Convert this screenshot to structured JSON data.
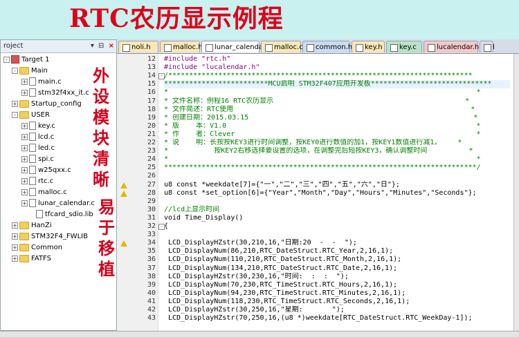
{
  "banner": {
    "title": "RTC农历显示例程"
  },
  "side_text": {
    "left": "外设模块清晰",
    "right": "易于移植"
  },
  "project": {
    "header": "roject",
    "controls": {
      "pin": "▾",
      "dock": "⊟",
      "close": "×"
    },
    "tree": [
      {
        "label": "Target 1",
        "type": "target",
        "exp": "-"
      },
      {
        "label": "Main",
        "type": "folder",
        "exp": "-"
      },
      {
        "label": "main.c",
        "type": "file",
        "exp": "+"
      },
      {
        "label": "stm32f4xx_it.c",
        "type": "file",
        "exp": "+"
      },
      {
        "label": "Startup_config",
        "type": "folder",
        "exp": "+"
      },
      {
        "label": "USER",
        "type": "folder",
        "exp": "-"
      },
      {
        "label": "key.c",
        "type": "file",
        "exp": "+"
      },
      {
        "label": "lcd.c",
        "type": "file",
        "exp": "+"
      },
      {
        "label": "led.c",
        "type": "file",
        "exp": "+"
      },
      {
        "label": "spi.c",
        "type": "file",
        "exp": "+"
      },
      {
        "label": "w25qxx.c",
        "type": "file",
        "exp": "+"
      },
      {
        "label": "rtc.c",
        "type": "file",
        "exp": "+"
      },
      {
        "label": "malloc.c",
        "type": "file",
        "exp": "+"
      },
      {
        "label": "lunar_calendar.c",
        "type": "file",
        "exp": "+"
      },
      {
        "label": "tfcard_sdio.lib",
        "type": "file",
        "exp": ""
      },
      {
        "label": "HanZi",
        "type": "folder",
        "exp": "+"
      },
      {
        "label": "STM32F4_FWLIB",
        "type": "folder",
        "exp": "+"
      },
      {
        "label": "Common",
        "type": "folder",
        "exp": "+"
      },
      {
        "label": "FATFS",
        "type": "folder",
        "exp": "+"
      }
    ]
  },
  "tabs": [
    {
      "label": "noli.h",
      "color": "#f8e7b8"
    },
    {
      "label": "malloc.h",
      "color": "#f8e7b8"
    },
    {
      "label": "lunar_calendar.c",
      "color": "#ffffff"
    },
    {
      "label": "malloc.c",
      "color": "#f8e7b8"
    },
    {
      "label": "common.h",
      "color": "#c9dcf1"
    },
    {
      "label": "key.h",
      "color": "#f8e7b8"
    },
    {
      "label": "key.c",
      "color": "#b9e2c4"
    },
    {
      "label": "lucalendar.h",
      "color": "#f3c8c8"
    },
    {
      "label": "l",
      "color": "#d7dde6"
    }
  ],
  "code_lines": [
    {
      "n": "12",
      "text": "#include \"rtc.h\"",
      "cls": "pp"
    },
    {
      "n": "13",
      "text": "#include \"lucalendar.h\"",
      "cls": "pp"
    },
    {
      "n": "14",
      "text": "/*************************************************************************",
      "cls": "cmt",
      "fold": "-"
    },
    {
      "n": "15",
      "text": "*************************MCU启明 STM32F407应用开发板*****************************",
      "cls": "cmt hl"
    },
    {
      "n": "16",
      "text": "*                                                                          *",
      "cls": "cmt"
    },
    {
      "n": "17",
      "text": "* 文件名称：例程16 RTC农历显示                                              *",
      "cls": "cmt"
    },
    {
      "n": "18",
      "text": "* 文件简述：RTC使用                                                         *",
      "cls": "cmt"
    },
    {
      "n": "19",
      "text": "* 创建日期：2015.03.15                                                      *",
      "cls": "cmt"
    },
    {
      "n": "20",
      "text": "* 版    本：V1.0                                                            *",
      "cls": "cmt"
    },
    {
      "n": "21",
      "text": "* 作    者：Clever                                                          *",
      "cls": "cmt"
    },
    {
      "n": "22",
      "text": "* 说    明：长按按KEY3进行时间调整，按KEY0进行数值的加1，按KEY1数值进行减1，    *",
      "cls": "cmt"
    },
    {
      "n": "23",
      "text": "*           按KEY2右移选择要设置的选项，在调整完后短按KEY3，确认调整时间          *",
      "cls": "cmt"
    },
    {
      "n": "24",
      "text": "*                                                                          *",
      "cls": "cmt"
    },
    {
      "n": "25",
      "text": "***************************************************************************/",
      "cls": "cmt"
    },
    {
      "n": "26",
      "text": "",
      "cls": ""
    },
    {
      "n": "27",
      "text": "u8 const *weekdate[7]={\"一\",\"二\",\"三\",\"四\",\"五\",\"六\",\"日\"};",
      "cls": "",
      "warn": true
    },
    {
      "n": "28",
      "text": "u8 const *set_option[6]={\"Year\",\"Month\",\"Day\",\"Hours\",\"Minutes\",\"Seconds\"};",
      "cls": "",
      "warn": true
    },
    {
      "n": "29",
      "text": "",
      "cls": ""
    },
    {
      "n": "30",
      "text": "//lcd上显示时间",
      "cls": "cmt"
    },
    {
      "n": "31",
      "text": "void Time_Display()",
      "cls": ""
    },
    {
      "n": "32",
      "text": "{",
      "cls": "",
      "fold": "-"
    },
    {
      "n": "33",
      "text": "",
      "cls": ""
    },
    {
      "n": "34",
      "text": " LCD_DisplayHZstr(30,210,16,\"日期:20  -  -  \");",
      "cls": "",
      "warn": true
    },
    {
      "n": "35",
      "text": " LCD_DisplayNum(86,210,RTC_DateStruct.RTC_Year,2,16,1);",
      "cls": ""
    },
    {
      "n": "36",
      "text": " LCD_DisplayNum(110,210,RTC_DateStruct.RTC_Month,2,16,1);",
      "cls": ""
    },
    {
      "n": "37",
      "text": " LCD_DisplayNum(134,210,RTC_DateStruct.RTC_Date,2,16,1);",
      "cls": ""
    },
    {
      "n": "38",
      "text": " LCD_DisplayHZstr(30,230,16,\"时间:  :  :  \");",
      "cls": ""
    },
    {
      "n": "39",
      "text": " LCD_DisplayNum(70,230,RTC_TimeStruct.RTC_Hours,2,16,1);",
      "cls": ""
    },
    {
      "n": "40",
      "text": " LCD_DisplayNum(94,230,RTC_TimeStruct.RTC_Minutes,2,16,1);",
      "cls": ""
    },
    {
      "n": "41",
      "text": " LCD_DisplayNum(118,230,RTC_TimeStruct.RTC_Seconds,2,16,1);",
      "cls": ""
    },
    {
      "n": "42",
      "text": " LCD_DisplayHZstr(30,250,16,\"星期:       \");",
      "cls": ""
    },
    {
      "n": "43",
      "text": " LCD_DisplayHZstr(70,250,16,(u8 *)weekdate[RTC_DateStruct.RTC_WeekDay-1]);",
      "cls": ""
    }
  ]
}
